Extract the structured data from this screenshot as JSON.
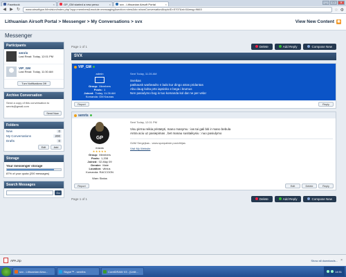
{
  "browser": {
    "tabs": [
      {
        "label": "Facebook",
        "active": false,
        "favicon": "facebook-icon"
      },
      {
        "label": "GP_GM started a new perso",
        "active": false,
        "favicon": "gmail-icon"
      },
      {
        "label": "svx - Lithuanian Airsoft Portal",
        "active": true,
        "favicon": "site-icon"
      }
    ],
    "url": "www.airsoftgun.lt/invision/index.php?app=members&module=messaging&section=view&do=showConversation&topicID=5707&st=0&msg=9663",
    "window_controls": [
      "_",
      "□",
      "✕"
    ]
  },
  "site": {
    "breadcrumb": "Lithuanian Airsoft Portal > Messenger > My Conversations > svx",
    "new_content": "View New Content",
    "page_title": "Messenger"
  },
  "sidebar": {
    "participants_title": "Participants",
    "participants": [
      {
        "name": "senris",
        "last_read": "Last Read: Today, 12:01 PM"
      },
      {
        "name": "VIP_GM",
        "last_read": "Last Read: Today, 11:30 AM"
      }
    ],
    "turn_off_btn": "Turn Notifications Off",
    "archive_title": "Archive Conversation",
    "archive_text": "Send a copy of this conversation to senris@gmail.com",
    "send_now": "Send Now",
    "folders_title": "Folders",
    "folders": [
      {
        "name": "New",
        "count": "0"
      },
      {
        "name": "My Conversations",
        "count": "200"
      },
      {
        "name": "Drafts",
        "count": "0"
      }
    ],
    "edit_btn": "Edit",
    "add_btn": "Add",
    "storage_title": "Storage",
    "storage_label": "Your messenger storage",
    "storage_fraction": 0.87,
    "storage_text": "87% of your quota (200 messages)",
    "search_title": "Search Messages",
    "go_btn": "Go"
  },
  "main": {
    "page_of": "Page 1 of 1",
    "delete_btn": "Delete",
    "add_reply_btn": "Add Reply",
    "compose_btn": "Compose New",
    "conversation_title": "SVX",
    "posts": [
      {
        "author": "VIP_GM",
        "selected": true,
        "posted": "Sent Today, 11:26 AM",
        "rank": "admin",
        "stats": [
          {
            "k": "Group:",
            "v": "Members"
          },
          {
            "k": "Posts:",
            "v": "1"
          },
          {
            "k": "Joined:",
            "v": "Today, 11:26 AM"
          }
        ],
        "location": "Kaunas",
        "member_no": "Komanda: GM Kaunas",
        "lines": [
          "Sveikas",
          "patikausk warbeadro n lado kur dingo atras pridantas",
          "Abu daug kolta prts iapsisko e bega i krumus",
          "Nen pasiulymo bog is tuo komanda kol dar ne per vela!"
        ],
        "report_btn": "Report",
        "reply_btn": "Reply"
      },
      {
        "author": "senris",
        "selected": false,
        "posted": "Sent Today, 12:01 PM",
        "rank": "mazas",
        "stats": [
          {
            "k": "Group:",
            "v": "Members"
          },
          {
            "k": "Posts:",
            "v": "1,208"
          },
          {
            "k": "Joined:",
            "v": "02-May 09"
          },
          {
            "k": "Gender:",
            "v": "Male"
          },
          {
            "k": "Location:",
            "v": "vilnius"
          }
        ],
        "location": "vilnius",
        "member_no": "Komanda: RACCOON",
        "lines": [
          "Visu pirma reikia pristatyti, mano manymu : ias tai gali biti ir mano bebula",
          "Antra aciu uz pasiepimas , bet manau susitaikysiu : nuo pasiulymo"
        ],
        "signature": "GAM Sergejkas - www.sparpalwie.pusivitrijas",
        "visit_site": "Visit My Website",
        "warn": "Warn Status",
        "report_btn": "Report",
        "edit_btn": "Edit",
        "delete_btn": "Delete",
        "reply_btn": "Reply"
      }
    ]
  },
  "download": {
    "file": "APA.zip",
    "show_all": "Show all downloads...",
    "close": "×"
  },
  "taskbar": {
    "items": [
      {
        "label": "svx - Lithuanian Airso...",
        "color": "#e86a1c"
      },
      {
        "label": "Skype™ - senribs",
        "color": "#1aa3e8"
      },
      {
        "label": "CorelDRAW X3 - [Untit...",
        "color": "#3c9a2c"
      }
    ],
    "time": "14:51"
  }
}
